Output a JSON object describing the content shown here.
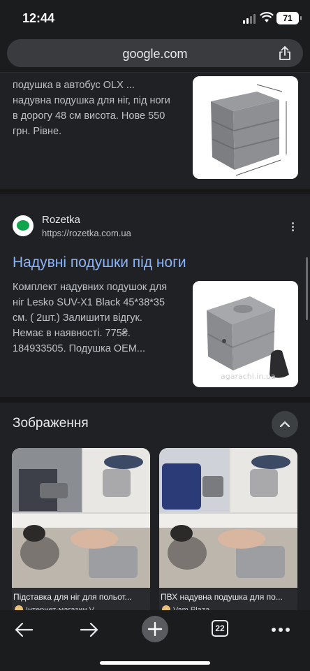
{
  "status": {
    "time": "12:44",
    "battery": "71"
  },
  "browser": {
    "url": "google.com",
    "tab_count": "22"
  },
  "result1": {
    "snippet_lines": [
      "подушка в автобус OLX ...",
      "надувна подушка для ніг, під ноги",
      "в дорогу 48 см висота. Нове 550",
      "грн. Рівне."
    ]
  },
  "result2": {
    "source_name": "Rozetka",
    "source_url": "https://rozetka.com.ua",
    "title": "Надувні подушки під ноги",
    "snippet_lines": [
      "Комплект надувних подушок для",
      "ніг Lesko SUV-X1 Black 45*38*35",
      "см. ( 2шт.) Залишити відгук.",
      "Немає в наявності. 775₴.",
      "184933505. Подушка OEM..."
    ]
  },
  "images": {
    "section_title": "Зображення",
    "items": [
      {
        "caption": "Підставка для ніг для польот...",
        "store": "Інтернет-магазин V..."
      },
      {
        "caption": "ПВХ надувна подушка для по...",
        "store": "Vam Plaza"
      }
    ]
  }
}
